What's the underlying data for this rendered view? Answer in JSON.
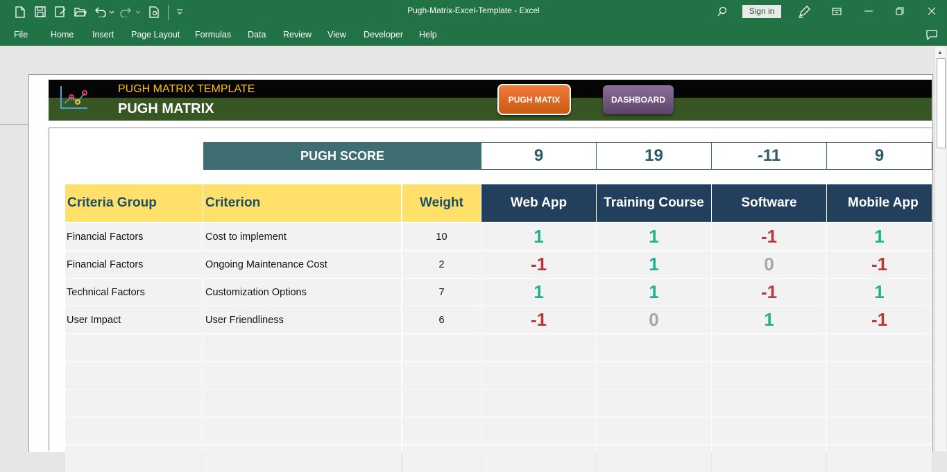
{
  "window": {
    "title": "Pugh-Matrix-Excel-Template  -  Excel",
    "sign_in": "Sign in"
  },
  "ribbon": {
    "tabs": [
      "File",
      "Home",
      "Insert",
      "Page Layout",
      "Formulas",
      "Data",
      "Review",
      "View",
      "Developer",
      "Help"
    ]
  },
  "banner": {
    "subtitle": "PUGH MATRIX TEMPLATE",
    "title": "PUGH MATRIX",
    "nav_buttons": [
      "PUGH MATIX",
      "DASHBOARD"
    ]
  },
  "score": {
    "label": "PUGH SCORE",
    "values": [
      "9",
      "19",
      "-11",
      "9"
    ]
  },
  "table": {
    "headers": [
      "Criteria Group",
      "Criterion",
      "Weight"
    ],
    "options": [
      "Web App",
      "Training Course",
      "Software",
      "Mobile App"
    ],
    "rows": [
      {
        "group": "Financial Factors",
        "criterion": "Cost to implement",
        "weight": "10",
        "scores": [
          "1",
          "1",
          "-1",
          "1"
        ]
      },
      {
        "group": "Financial Factors",
        "criterion": "Ongoing Maintenance Cost",
        "weight": "2",
        "scores": [
          "-1",
          "1",
          "0",
          "-1"
        ]
      },
      {
        "group": "Technical Factors",
        "criterion": "Customization Options",
        "weight": "7",
        "scores": [
          "1",
          "1",
          "-1",
          "1"
        ]
      },
      {
        "group": "User Impact",
        "criterion": "User Friendliness",
        "weight": "6",
        "scores": [
          "-1",
          "0",
          "1",
          "-1"
        ]
      }
    ],
    "empty_rows": 5
  },
  "colors": {
    "positive": "#1bb28e",
    "negative": "#b8383b",
    "neutral": "#a6a6a6",
    "excel_green": "#217346",
    "header_blue": "#223f5e",
    "header_yellow": "#ffe06a",
    "score_teal": "#3f6e72"
  }
}
